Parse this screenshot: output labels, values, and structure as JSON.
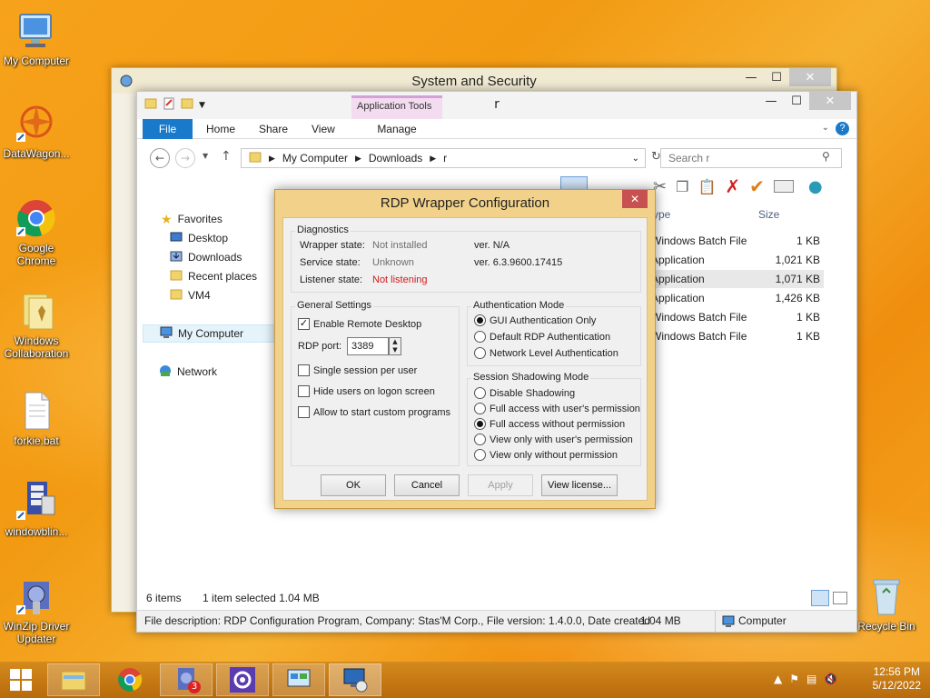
{
  "desktop": {
    "icons": [
      {
        "label": "My Computer"
      },
      {
        "label": "DataWagon..."
      },
      {
        "label": "Google Chrome"
      },
      {
        "label": "Windows Collaboration"
      },
      {
        "label": "forkie.bat"
      },
      {
        "label": "windowblin..."
      },
      {
        "label": "WinZip Driver Updater"
      },
      {
        "label": "Recycle Bin"
      }
    ]
  },
  "back_window": {
    "title": "System and Security"
  },
  "explorer": {
    "title": "r",
    "ribbon": {
      "context_label": "Application Tools",
      "tabs": {
        "file": "File",
        "home": "Home",
        "share": "Share",
        "view": "View",
        "manage": "Manage"
      }
    },
    "address": {
      "crumbs": [
        "My Computer",
        "Downloads",
        "r"
      ]
    },
    "search_placeholder": "Search r",
    "nav": {
      "favorites": "Favorites",
      "desktop": "Desktop",
      "downloads": "Downloads",
      "recent": "Recent places",
      "vm4": "VM4",
      "my_computer": "My Computer",
      "network": "Network"
    },
    "columns": {
      "type": "ype",
      "size": "Size"
    },
    "rows": [
      {
        "type": "Windows Batch File",
        "size": "1 KB"
      },
      {
        "type": "Application",
        "size": "1,021 KB"
      },
      {
        "type": "Application",
        "size": "1,071 KB"
      },
      {
        "type": "Application",
        "size": "1,426 KB"
      },
      {
        "type": "Windows Batch File",
        "size": "1 KB"
      },
      {
        "type": "Windows Batch File",
        "size": "1 KB"
      }
    ],
    "status": {
      "items": "6 items",
      "selected": "1 item selected  1.04 MB"
    },
    "desc": {
      "text": "File description: RDP Configuration Program, Company: Stas'M Corp., File version: 1.4.0.0, Date created",
      "size": "1.04 MB",
      "location": "Computer"
    }
  },
  "rdp": {
    "title": "RDP Wrapper Configuration",
    "diagnostics": {
      "title": "Diagnostics",
      "wrapper_label": "Wrapper state:",
      "wrapper_value": "Not installed",
      "wrapper_ver": "ver. N/A",
      "service_label": "Service state:",
      "service_value": "Unknown",
      "service_ver": "ver. 6.3.9600.17415",
      "listener_label": "Listener state:",
      "listener_value": "Not listening",
      "listener_color": "#d01a1a"
    },
    "general": {
      "title": "General Settings",
      "enable_remote": "Enable Remote Desktop",
      "rdp_port_label": "RDP port:",
      "rdp_port": "3389",
      "single_session": "Single session per user",
      "hide_users": "Hide users on logon screen",
      "custom_programs": "Allow to start custom programs"
    },
    "auth": {
      "title": "Authentication Mode",
      "gui": "GUI Authentication Only",
      "default": "Default RDP Authentication",
      "nla": "Network Level Authentication"
    },
    "shadow": {
      "title": "Session Shadowing Mode",
      "disable": "Disable Shadowing",
      "full_perm": "Full access with user's permission",
      "full_noperm": "Full access without permission",
      "view_perm": "View only with user's permission",
      "view_noperm": "View only without permission"
    },
    "buttons": {
      "ok": "OK",
      "cancel": "Cancel",
      "apply": "Apply",
      "license": "View license..."
    }
  },
  "taskbar": {
    "badge": "3",
    "time": "12:56 PM",
    "date": "5/12/2022"
  }
}
